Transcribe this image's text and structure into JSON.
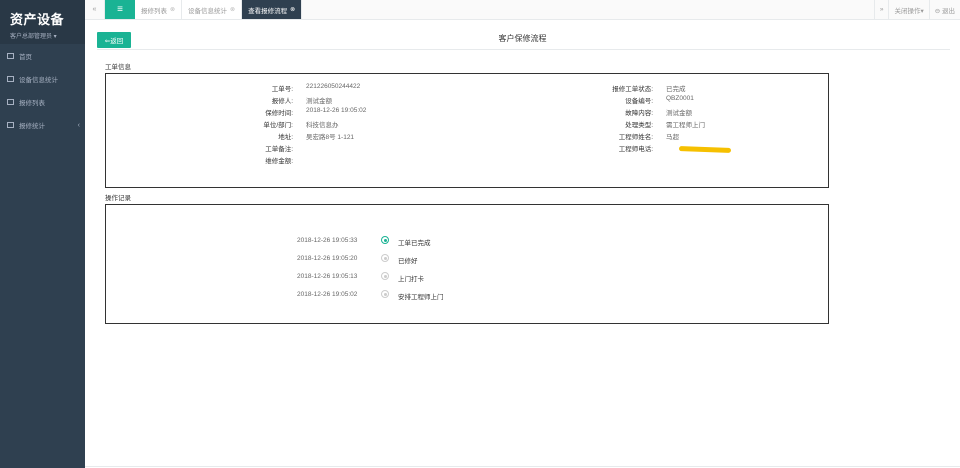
{
  "sidebar": {
    "brand_title": "资产设备",
    "brand_sub": "客户总部管理员 ▾",
    "items": [
      {
        "label": "首页"
      },
      {
        "label": "设备信息统计"
      },
      {
        "label": "报修列表"
      },
      {
        "label": "报修统计",
        "arrow": "‹"
      }
    ]
  },
  "topbar": {
    "prev_icon": "«",
    "menu_icon": "≡",
    "tabs": [
      {
        "label": "报修列表",
        "close": "⊗"
      },
      {
        "label": "设备信息统计",
        "close": "⊗"
      },
      {
        "label": "查看报修流程",
        "close": "⊗"
      }
    ],
    "next_icon": "»",
    "close_ops": "关闭操作▾",
    "logout": "⊖ 退出"
  },
  "main": {
    "back_label": "⇐返回",
    "title": "客户保修流程",
    "section_workorder": "工单信息",
    "section_log": "操作记录",
    "left_fields": [
      {
        "label": "工单号:",
        "value": "221226050244422"
      },
      {
        "label": "报修人:",
        "value": "测试金额"
      },
      {
        "label": "保修时间:",
        "value": "2018-12-26 19:05:02"
      },
      {
        "label": "单位/部门:",
        "value": "科技信息办"
      },
      {
        "label": "地址:",
        "value": "吴宏路8号 1-121"
      },
      {
        "label": "工单备注:",
        "value": ""
      },
      {
        "label": "维修金额:",
        "value": ""
      }
    ],
    "right_fields": [
      {
        "label": "报修工单状态:",
        "value": "已完成"
      },
      {
        "label": "设备编号:",
        "value": "QBZ0001"
      },
      {
        "label": "故障内容:",
        "value": "测试金额"
      },
      {
        "label": "处理类型:",
        "value": "需工程师上门"
      },
      {
        "label": "工程师姓名:",
        "value": "马超"
      },
      {
        "label": "工程师电话:",
        "value": ""
      }
    ],
    "timeline": [
      {
        "time": "2018-12-26 19:05:33",
        "text": "工单已完成",
        "active": true
      },
      {
        "time": "2018-12-26 19:05:20",
        "text": "已修好",
        "active": false
      },
      {
        "time": "2018-12-26 19:05:13",
        "text": "上门打卡",
        "active": false
      },
      {
        "time": "2018-12-26 19:05:02",
        "text": "安排工程师上门",
        "active": false
      }
    ]
  },
  "colors": {
    "accent": "#1ab394",
    "sidebar": "#2f4050",
    "redaction": "#f6c000"
  }
}
